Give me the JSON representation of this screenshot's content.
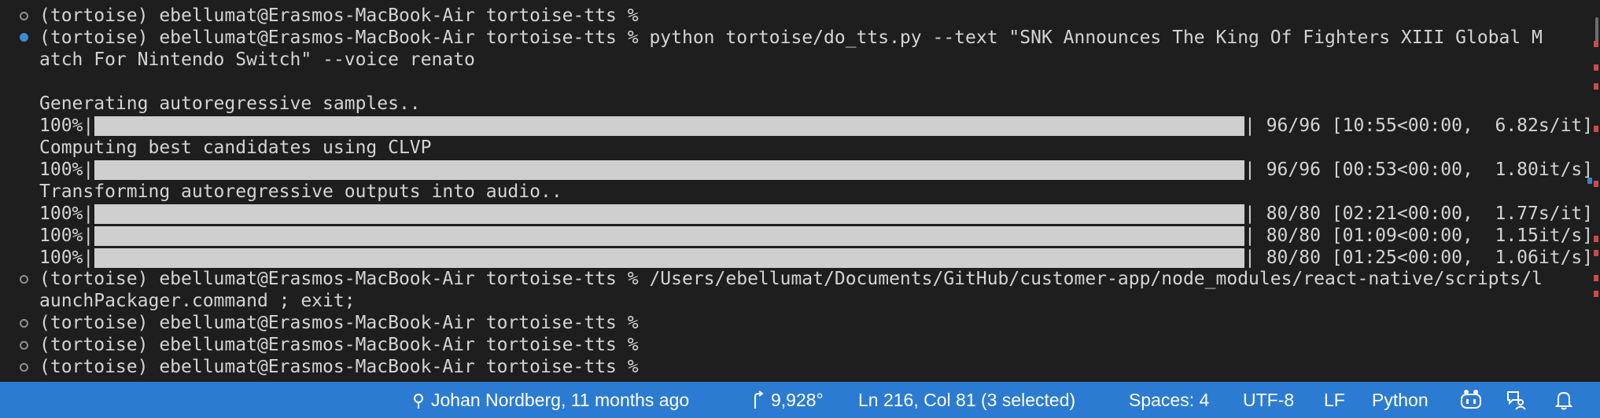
{
  "terminal": {
    "prompt": "(tortoise) ebellumat@Erasmos-MacBook-Air tortoise-tts %",
    "command_line1": "(tortoise) ebellumat@Erasmos-MacBook-Air tortoise-tts % python tortoise/do_tts.py --text \"SNK Announces The King Of Fighters XIII Global M",
    "command_line2": "atch For Nintendo Switch\" --voice renato",
    "generating": "Generating autoregressive samples..",
    "computing": "Computing best candidates using CLVP",
    "transforming": "Transforming autoregressive outputs into audio..",
    "progress": [
      {
        "percent_label": "100%|",
        "fraction": 1.0,
        "stats": "| 96/96 [10:55<00:00,  6.82s/it]"
      },
      {
        "percent_label": "100%|",
        "fraction": 1.0,
        "stats": "| 96/96 [00:53<00:00,  1.80it/s]"
      },
      {
        "percent_label": "100%|",
        "fraction": 1.0,
        "stats": "| 80/80 [02:21<00:00,  1.77s/it]"
      },
      {
        "percent_label": "100%|",
        "fraction": 1.0,
        "stats": "| 80/80 [01:09<00:00,  1.15it/s]"
      },
      {
        "percent_label": "100%|",
        "fraction": 1.0,
        "stats": "| 80/80 [01:25<00:00,  1.06it/s]"
      }
    ],
    "packager_line1": "(tortoise) ebellumat@Erasmos-MacBook-Air tortoise-tts % /Users/ebellumat/Documents/GitHub/customer-app/node_modules/react-native/scripts/l",
    "packager_line2": "aunchPackager.command ; exit;"
  },
  "statusbar": {
    "blame": "Johan Nordberg, 11 months ago",
    "degrees": "9,928°",
    "cursor": "Ln 216, Col 81 (3 selected)",
    "spaces": "Spaces: 4",
    "encoding": "UTF-8",
    "eol": "LF",
    "language": "Python",
    "background": "#2b7bd2",
    "icons": [
      "git-commit-icon",
      "branch-arrow-icon",
      "copilot-icon",
      "feedback-icon",
      "bell-icon"
    ]
  }
}
